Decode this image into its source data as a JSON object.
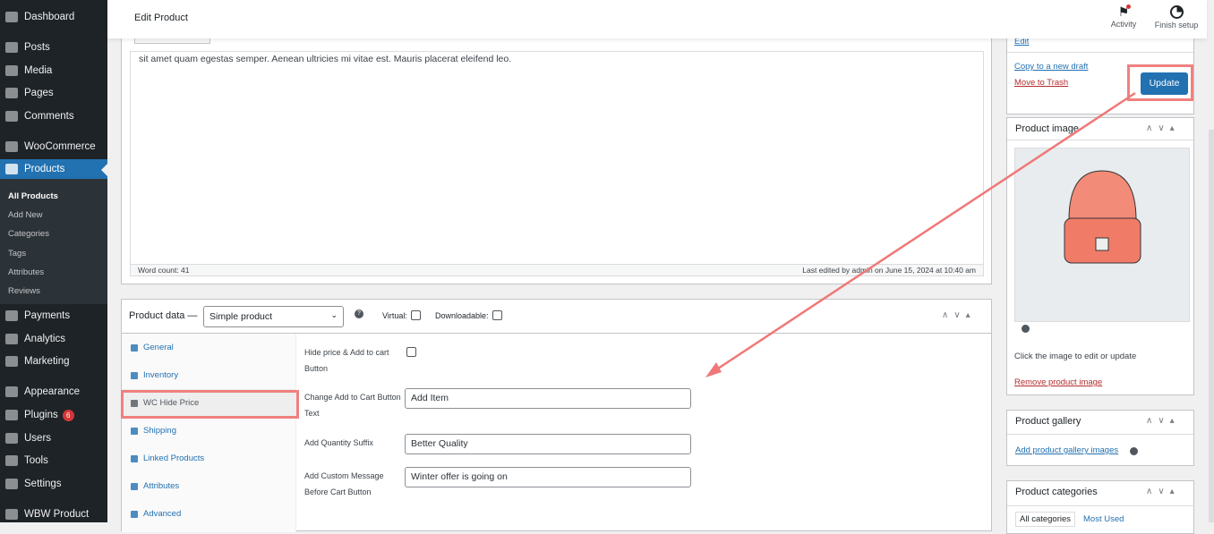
{
  "sidebar": {
    "items": [
      {
        "label": "Dashboard"
      },
      {
        "label": "Posts"
      },
      {
        "label": "Media"
      },
      {
        "label": "Pages"
      },
      {
        "label": "Comments"
      },
      {
        "label": "WooCommerce"
      },
      {
        "label": "Products"
      },
      {
        "label": "Payments"
      },
      {
        "label": "Analytics"
      },
      {
        "label": "Marketing"
      },
      {
        "label": "Appearance"
      },
      {
        "label": "Plugins",
        "badge": "6"
      },
      {
        "label": "Users"
      },
      {
        "label": "Tools"
      },
      {
        "label": "Settings"
      },
      {
        "label": "WBW Product"
      }
    ],
    "submenu": [
      "All Products",
      "Add New",
      "Categories",
      "Tags",
      "Attributes",
      "Reviews"
    ]
  },
  "header": {
    "title": "Edit Product",
    "activity": "Activity",
    "finish_setup": "Finish setup"
  },
  "editor": {
    "text": "sit amet quam egestas semper. Aenean ultricies mi vitae est. Mauris placerat eleifend leo.",
    "word_count": "Word count: 41",
    "last_edited": "Last edited by admin on June 15, 2024 at 10:40 am"
  },
  "product_data": {
    "title": "Product data —",
    "type": "Simple product",
    "virtual": "Virtual:",
    "downloadable": "Downloadable:",
    "tabs": [
      "General",
      "Inventory",
      "WC Hide Price",
      "Shipping",
      "Linked Products",
      "Attributes",
      "Advanced"
    ],
    "fields": {
      "hide_label": "Hide price & Add to cart Button",
      "cart_text_label": "Change Add to Cart Button Text",
      "cart_text_value": "Add Item",
      "suffix_label": "Add Quantity Suffix",
      "suffix_value": "Better Quality",
      "message_label": "Add Custom Message Before Cart Button",
      "message_value": "Winter offer is going on"
    }
  },
  "publish": {
    "edit": "Edit",
    "copy": "Copy to a new draft",
    "trash": "Move to Trash",
    "update": "Update"
  },
  "product_image": {
    "title": "Product image",
    "hint": "Click the image to edit or update",
    "remove": "Remove product image"
  },
  "gallery": {
    "title": "Product gallery",
    "add": "Add product gallery images"
  },
  "categories": {
    "title": "Product categories",
    "tab_all": "All categories",
    "tab_used": "Most Used"
  }
}
